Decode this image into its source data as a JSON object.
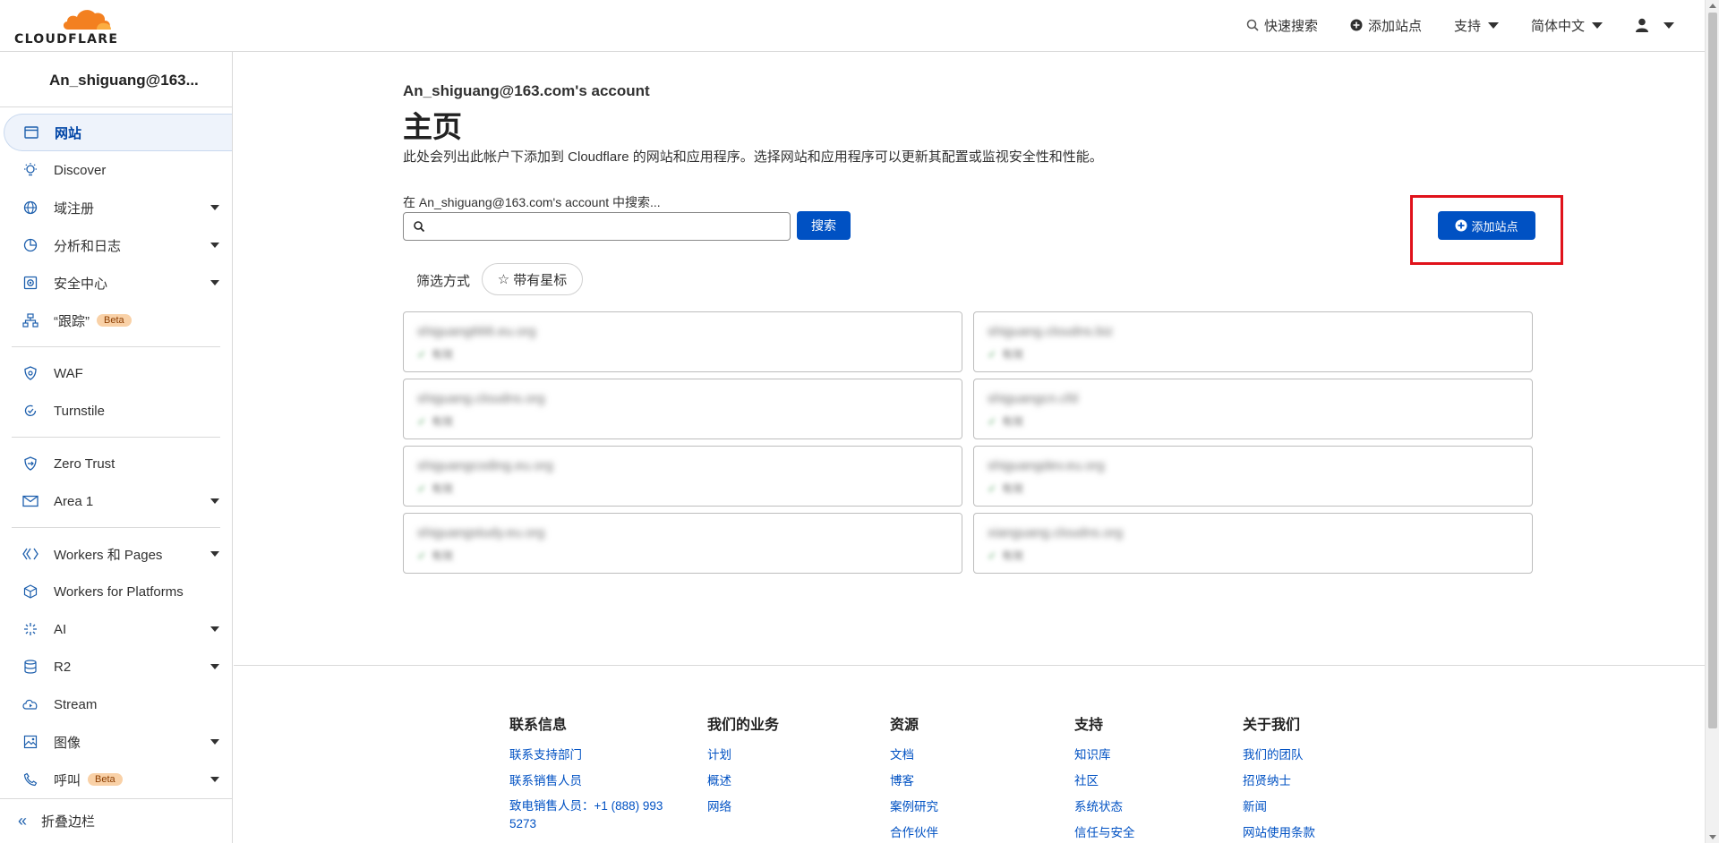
{
  "header": {
    "logo_text": "CLOUDFLARE",
    "quick_search": "快速搜索",
    "add_site": "添加站点",
    "support": "支持",
    "language": "简体中文"
  },
  "sidebar": {
    "account": "An_shiguang@163...",
    "items": [
      {
        "label": "网站",
        "icon": "browser-window-icon"
      },
      {
        "label": "Discover",
        "icon": "lightbulb-icon"
      },
      {
        "label": "域注册",
        "icon": "globe-icon"
      },
      {
        "label": "分析和日志",
        "icon": "pie-chart-icon"
      },
      {
        "label": "安全中心",
        "icon": "security-center-icon"
      },
      {
        "label": "“跟踪”",
        "icon": "sitemap-icon"
      },
      {
        "label": "WAF",
        "icon": "shield-icon"
      },
      {
        "label": "Turnstile",
        "icon": "turnstile-icon"
      },
      {
        "label": "Zero Trust",
        "icon": "zero-trust-icon"
      },
      {
        "label": "Area 1",
        "icon": "envelope-icon"
      },
      {
        "label": "Workers 和 Pages",
        "icon": "workers-icon"
      },
      {
        "label": "Workers for Platforms",
        "icon": "cube-icon"
      },
      {
        "label": "AI",
        "icon": "sparkle-icon"
      },
      {
        "label": "R2",
        "icon": "database-icon"
      },
      {
        "label": "Stream",
        "icon": "stream-icon"
      },
      {
        "label": "图像",
        "icon": "image-icon"
      },
      {
        "label": "呼叫",
        "icon": "phone-icon"
      }
    ],
    "beta": "Beta",
    "collapse": "折叠边栏"
  },
  "main": {
    "account_title": "An_shiguang@163.com's account",
    "title": "主页",
    "description": "此处会列出此帐户下添加到 Cloudflare 的网站和应用程序。选择网站和应用程序可以更新其配置或监视安全性和性能。",
    "search_label": "在 An_shiguang@163.com's account 中搜索...",
    "search_value": "",
    "search_button": "搜索",
    "filter_label": "筛选方式",
    "starred": "带有星标",
    "add_site_button": "添加站点"
  },
  "sites": [
    {
      "domain": "shiguang666.eu.org",
      "status": "有效"
    },
    {
      "domain": "shiguang.cloudns.biz",
      "status": "有效"
    },
    {
      "domain": "shiguang.cloudns.org",
      "status": "有效"
    },
    {
      "domain": "shiguangcn.cfd",
      "status": "有效"
    },
    {
      "domain": "shiguangcoding.eu.org",
      "status": "有效"
    },
    {
      "domain": "shiguangdev.eu.org",
      "status": "有效"
    },
    {
      "domain": "shiguangstudy.eu.org",
      "status": "有效"
    },
    {
      "domain": "xianguang.cloudns.org",
      "status": "有效"
    }
  ],
  "footer": {
    "contact": {
      "title": "联系信息",
      "links": [
        "联系支持部门",
        "联系销售人员",
        "致电销售人员：+1 (888) 993 5273"
      ]
    },
    "business": {
      "title": "我们的业务",
      "links": [
        "计划",
        "概述",
        "网络"
      ]
    },
    "resources": {
      "title": "资源",
      "links": [
        "文档",
        "博客",
        "案例研究",
        "合作伙伴"
      ]
    },
    "support": {
      "title": "支持",
      "links": [
        "知识库",
        "社区",
        "系统状态",
        "信任与安全"
      ]
    },
    "about": {
      "title": "关于我们",
      "links": [
        "我们的团队",
        "招贤纳士",
        "新闻",
        "网站使用条款"
      ]
    }
  },
  "colors": {
    "accent": "#0051c3",
    "highlight": "#e0121b",
    "logo_orange": "#f38020"
  }
}
